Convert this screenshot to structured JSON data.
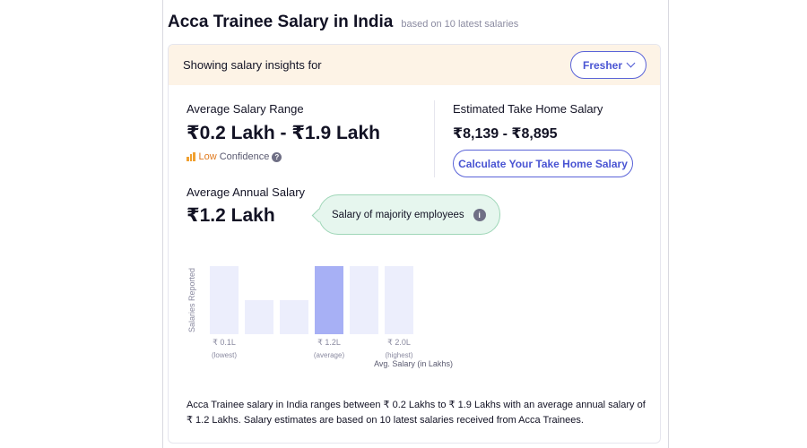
{
  "header": {
    "title": "Acca Trainee Salary in India",
    "subtitle": "based on 10 latest salaries"
  },
  "insights_bar": {
    "text": "Showing salary insights for",
    "experience_selected": "Fresher"
  },
  "average_range": {
    "label": "Average Salary Range",
    "value": "₹0.2 Lakh - ₹1.9 Lakh",
    "confidence_level": "Low",
    "confidence_word": "Confidence"
  },
  "take_home": {
    "label": "Estimated Take Home Salary",
    "value": "₹8,139 - ₹8,895",
    "button_label": "Calculate Your Take Home Salary"
  },
  "annual": {
    "label": "Average Annual Salary",
    "value": "₹1.2 Lakh"
  },
  "tooltip": {
    "text": "Salary of majority employees"
  },
  "chart_data": {
    "type": "bar",
    "ylabel": "Salaries Reported",
    "xlabel": "Avg. Salary (in Lakhs)",
    "values": [
      2,
      1,
      1,
      2,
      2,
      2
    ],
    "highlight_index": 3,
    "tick_labels": [
      {
        "bar_index": 0,
        "value": "₹ 0.1L",
        "sub": "(lowest)"
      },
      {
        "bar_index": 3,
        "value": "₹ 1.2L",
        "sub": "(average)"
      },
      {
        "bar_index": 5,
        "value": "₹ 2.0L",
        "sub": "(highest)"
      }
    ],
    "colors": {
      "bar": "#eceefc",
      "highlight": "#a7b0f5",
      "text": "#8a8aa0"
    }
  },
  "summary": "Acca Trainee salary in India ranges between ₹ 0.2 Lakhs to ₹ 1.9 Lakhs with an average annual salary of ₹ 1.2 Lakhs. Salary estimates are based on 10 latest salaries received from Acca Trainees.",
  "colors": {
    "accent": "#4a55d3",
    "insights_bg": "#fdf3e6",
    "tooltip_bg": "#e6f6ee",
    "confidence_low": "#e07a1f"
  }
}
